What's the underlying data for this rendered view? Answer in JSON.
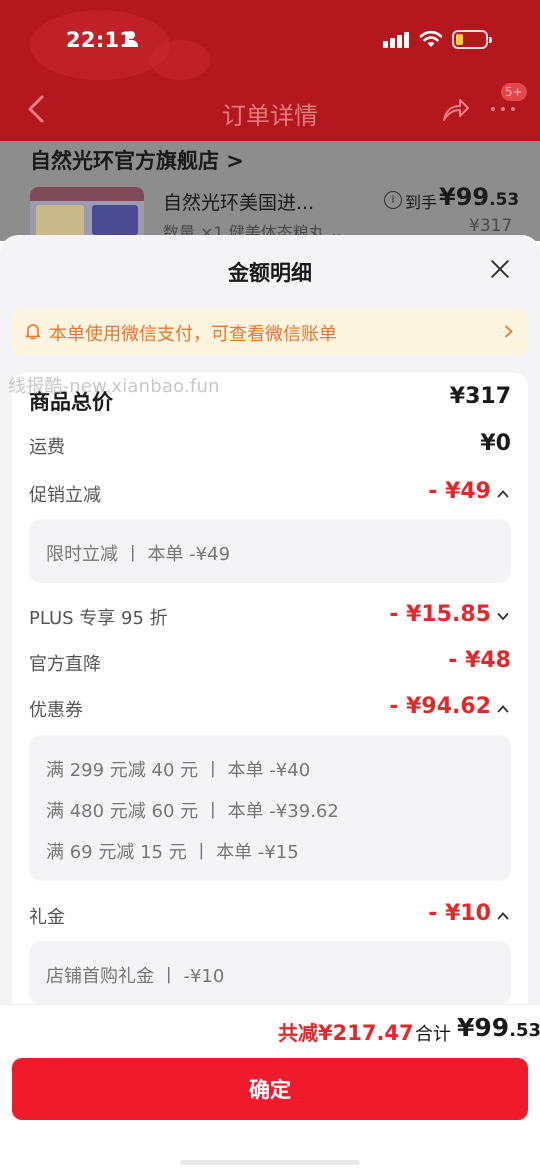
{
  "status_bar": {
    "time": "22:11"
  },
  "nav": {
    "title": "订单详情",
    "badge": "5+"
  },
  "order": {
    "store_name": "自然光环官方旗舰店 >",
    "product_name": "自然光环美国进...",
    "product_meta": "数量 ×1  健美体态粮丸 ⌄",
    "dao_shou_label": "到手",
    "dao_shou_price_main": "¥99",
    "dao_shou_price_dec": ".53",
    "original_price": "¥317"
  },
  "sheet": {
    "title": "金额明细",
    "notice": "本单使用微信支付，可查看微信账单",
    "watermark": "线报酷-new.xianbao.fun",
    "rows": {
      "total": {
        "label": "商品总价",
        "value": "¥317"
      },
      "shipping": {
        "label": "运费",
        "value": "¥0"
      },
      "promo": {
        "label": "促销立减",
        "value": "- ¥49",
        "detail": "限时立减  丨 本单 -¥49"
      },
      "plus": {
        "label": "PLUS 专享 95 折",
        "value": "- ¥15.85"
      },
      "official": {
        "label": "官方直降",
        "value": "- ¥48"
      },
      "coupon": {
        "label": "优惠券",
        "value": "- ¥94.62",
        "details": [
          "满 299 元减 40 元  丨 本单 -¥40",
          "满 480 元减 60 元  丨 本单 -¥39.62",
          "满 69 元减 15 元  丨 本单 -¥15"
        ]
      },
      "gift": {
        "label": "礼金",
        "value": "- ¥10",
        "detail": "店铺首购礼金  丨 -¥10"
      }
    }
  },
  "footer": {
    "saved_label": "共减",
    "saved_value": "¥217.47",
    "total_label": "合计",
    "total_main": "¥99",
    "total_dec": ".53",
    "confirm_label": "确定"
  },
  "colors": {
    "accent": "#e3272b",
    "button": "#f01b2a",
    "notice_text": "#e9752e",
    "header_bg": "#b4171e"
  }
}
